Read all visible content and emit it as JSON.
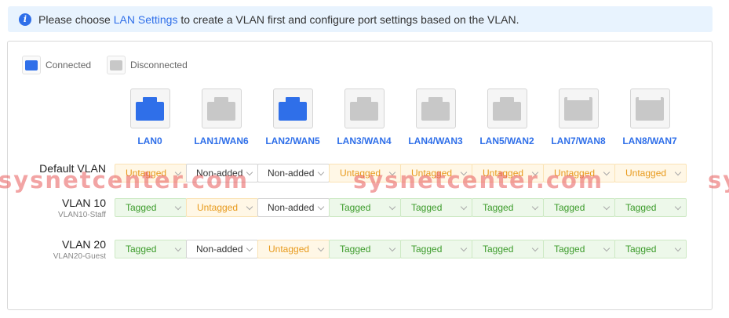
{
  "info": {
    "prefix": "Please choose ",
    "link": "LAN Settings",
    "suffix": " to create a VLAN first and configure port settings based on the VLAN."
  },
  "legend": {
    "connected": "Connected",
    "disconnected": "Disconnected"
  },
  "colors": {
    "connected": "#2f6fe9",
    "disconnected": "#c8c8c8",
    "tagged": "#3b9b2a",
    "untagged": "#e89a1c",
    "link": "#2f6fe9"
  },
  "ports": [
    {
      "label": "LAN0",
      "status": "connected"
    },
    {
      "label": "LAN1/WAN6",
      "status": "disconnected"
    },
    {
      "label": "LAN2/WAN5",
      "status": "connected"
    },
    {
      "label": "LAN3/WAN4",
      "status": "disconnected"
    },
    {
      "label": "LAN4/WAN3",
      "status": "disconnected"
    },
    {
      "label": "LAN5/WAN2",
      "status": "disconnected"
    },
    {
      "label": "LAN7/WAN8",
      "status": "disconnected"
    },
    {
      "label": "LAN8/WAN7",
      "status": "disconnected"
    }
  ],
  "vlans": [
    {
      "name": "Default VLAN",
      "sub": "",
      "values": [
        "Untagged",
        "Non-added",
        "Non-added",
        "Untagged",
        "Untagged",
        "Untagged",
        "Untagged",
        "Untagged"
      ]
    },
    {
      "name": "VLAN 10",
      "sub": "VLAN10-Staff",
      "values": [
        "Tagged",
        "Untagged",
        "Non-added",
        "Tagged",
        "Tagged",
        "Tagged",
        "Tagged",
        "Tagged"
      ]
    },
    {
      "name": "VLAN 20",
      "sub": "VLAN20-Guest",
      "values": [
        "Tagged",
        "Non-added",
        "Untagged",
        "Tagged",
        "Tagged",
        "Tagged",
        "Tagged",
        "Tagged"
      ]
    }
  ],
  "watermark": "sysnetcenter.com"
}
